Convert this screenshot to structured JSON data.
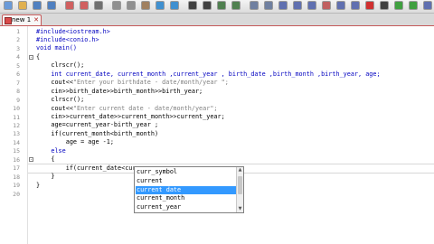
{
  "colors": {
    "accent_red": "#c45a5a",
    "keyword_blue": "#0000c0",
    "string_gray": "#808080",
    "selection": "#3399ff"
  },
  "tab": {
    "label": "new 1"
  },
  "editor": {
    "lines": [
      {
        "n": "1",
        "code": "#include<iostream.h>"
      },
      {
        "n": "2",
        "code": "#include<conio.h>"
      },
      {
        "n": "3",
        "code": "void main()"
      },
      {
        "n": "4",
        "code": "{"
      },
      {
        "n": "5",
        "code": "    clrscr();"
      },
      {
        "n": "6",
        "code": "    int current_date, current_month ,current_year , birth_date ,birth_month ,birth_year, age;"
      },
      {
        "n": "7",
        "code": "    cout<<\"Enter your birthdate - date/month/year \";"
      },
      {
        "n": "8",
        "code": "    cin>>birth_date>>birth_month>>birth_year;"
      },
      {
        "n": "9",
        "code": "    clrscr();"
      },
      {
        "n": "10",
        "code": "    cout<<\"Enter current date - date/month/year\";"
      },
      {
        "n": "11",
        "code": "    cin>>current_date>>current_month>>current_year;"
      },
      {
        "n": "12",
        "code": "    age=current_year-birth_year ;"
      },
      {
        "n": "13",
        "code": "    if(current_month<birth_month)"
      },
      {
        "n": "14",
        "code": "        age = age -1;"
      },
      {
        "n": "15",
        "code": "    else"
      },
      {
        "n": "16",
        "code": "    {"
      },
      {
        "n": "17",
        "code": "        if(current_date<curre"
      },
      {
        "n": "18",
        "code": "    }"
      },
      {
        "n": "19",
        "code": "}"
      },
      {
        "n": "20",
        "code": ""
      }
    ]
  },
  "autocomplete": {
    "items": [
      "curr_symbol",
      "current",
      "current date",
      "current_month",
      "current_year"
    ],
    "selected_index": 2
  },
  "toolbar": {
    "icons": [
      "new-icon",
      "open-icon",
      "save-icon",
      "save-all-icon",
      "close-icon",
      "close-all-icon",
      "print-icon",
      "cut-icon",
      "copy-icon",
      "paste-icon",
      "undo-icon",
      "redo-icon",
      "find-icon",
      "replace-icon",
      "zoom-in-icon",
      "zoom-out-icon",
      "sync-v-icon",
      "sync-h-icon",
      "wrap-icon",
      "all-chars-icon",
      "indent-guide-icon",
      "user-lang-icon",
      "doc-map-icon",
      "function-list-icon",
      "record-icon",
      "stop-icon",
      "play-icon",
      "play-multi-icon",
      "save-macro-icon"
    ]
  }
}
